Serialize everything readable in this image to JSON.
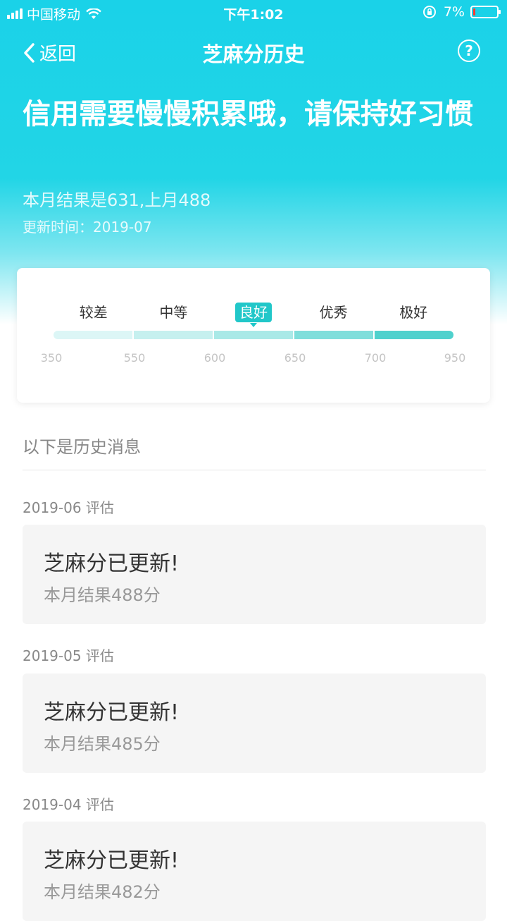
{
  "status_bar": {
    "carrier": "中国移动",
    "time": "下午1:02",
    "battery_text": "7%",
    "battery_level": 0.07
  },
  "nav": {
    "back_label": "返回",
    "title": "芝麻分历史",
    "help_label": "?"
  },
  "hero": {
    "headline": "信用需要慢慢积累哦，请保持好习惯",
    "result_line": "本月结果是631,上月488",
    "updated_line": "更新时间：2019-07"
  },
  "score_scale": {
    "levels": [
      "较差",
      "中等",
      "良好",
      "优秀",
      "极好"
    ],
    "active_level": "良好",
    "ticks": [
      "350",
      "550",
      "600",
      "650",
      "700",
      "950"
    ],
    "segment_colors": [
      "#dcf6f6",
      "#c6f0ef",
      "#a9e9e7",
      "#7fdedb",
      "#4fd1cd"
    ]
  },
  "history": {
    "title": "以下是历史消息",
    "entries": [
      {
        "date": "2019-06 评估",
        "title": "芝麻分已更新!",
        "detail": "本月结果488分"
      },
      {
        "date": "2019-05 评估",
        "title": "芝麻分已更新!",
        "detail": "本月结果485分"
      },
      {
        "date": "2019-04 评估",
        "title": "芝麻分已更新!",
        "detail": "本月结果482分"
      }
    ]
  },
  "colors": {
    "accent": "#21c7c9",
    "hero_top": "#1ad2e8"
  }
}
